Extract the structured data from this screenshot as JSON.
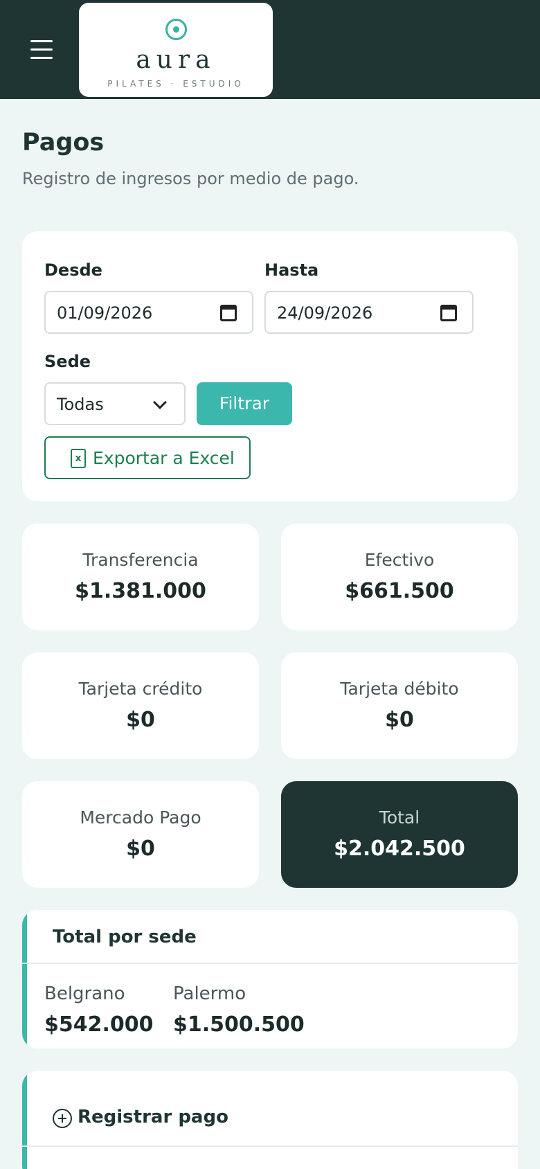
{
  "header": {
    "logo_name": "aura",
    "logo_tagline": "PILATES · ESTUDIO",
    "menu_icon": "hamburger-menu-icon",
    "logo_icon": "ring-dot-logo-icon"
  },
  "page": {
    "title": "Pagos",
    "subtitle": "Registro de ingresos por medio de pago."
  },
  "filters": {
    "from_label": "Desde",
    "from_value": "01/09/2026",
    "to_label": "Hasta",
    "to_value": "24/09/2026",
    "branch_label": "Sede",
    "branch_value": "Todas",
    "filter_button": "Filtrar",
    "export_button": "Exportar a Excel",
    "export_icon": "excel-file-icon"
  },
  "totals": [
    {
      "label": "Transferencia",
      "amount": "$1.381.000"
    },
    {
      "label": "Efectivo",
      "amount": "$661.500"
    },
    {
      "label": "Tarjeta crédito",
      "amount": "$0"
    },
    {
      "label": "Tarjeta débito",
      "amount": "$0"
    },
    {
      "label": "Mercado Pago",
      "amount": "$0"
    },
    {
      "label": "Total",
      "amount": "$2.042.500"
    }
  ],
  "by_branch": {
    "title": "Total por sede",
    "branches": [
      {
        "name": "Belgrano",
        "amount": "$542.000"
      },
      {
        "name": "Palermo",
        "amount": "$1.500.500"
      }
    ]
  },
  "register": {
    "title": "Registrar pago",
    "icon": "plus-circle-icon"
  },
  "colors": {
    "header_bg": "#1f3533",
    "accent": "#3cb7ad",
    "export_green": "#1e7d52",
    "page_bg": "#eef6f5"
  }
}
